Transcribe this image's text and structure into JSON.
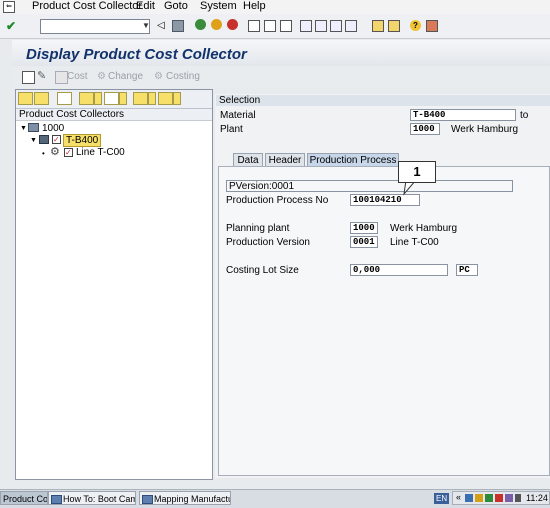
{
  "menu": {
    "items": [
      "Product Cost Collector",
      "Edit",
      "Goto",
      "System",
      "Help"
    ]
  },
  "command_field": {
    "value": ""
  },
  "title": "Display Product Cost Collector",
  "app_toolbar": {
    "cost": "Cost",
    "change": "Change",
    "costing": "Costing"
  },
  "tree": {
    "header": "Product Cost Collectors",
    "nodes": {
      "root": "1000",
      "material": "T-B400",
      "line": "Line T-C00"
    }
  },
  "selection": {
    "header": "Selection",
    "material_label": "Material",
    "material_value": "T-B400",
    "to_label": "to",
    "plant_label": "Plant",
    "plant_value": "1000",
    "plant_name": "Werk Hamburg"
  },
  "tabs": [
    "Data",
    "Header",
    "Production Process"
  ],
  "active_tab": "Production Process",
  "production_process": {
    "pversion": "PVersion:0001",
    "process_no_label": "Production Process No",
    "process_no_value": "100104210",
    "planning_plant_label": "Planning plant",
    "planning_plant_value": "1000",
    "planning_plant_name": "Werk Hamburg",
    "prod_version_label": "Production Version",
    "prod_version_value": "0001",
    "prod_version_name": "Line T-C00",
    "lot_size_label": "Costing Lot Size",
    "lot_size_value": "0,000",
    "lot_size_unit": "PC"
  },
  "callout_number": "1",
  "taskbar": {
    "tasks": [
      "Product Cost ...",
      "How To: Boot Camp - Ta...",
      "Mapping Manufacturing t..."
    ],
    "lang": "EN",
    "clock": "11:24"
  },
  "colors": {
    "title_text": "#12326b",
    "active_tab": "#c7d6e8",
    "selected_node": "#f7e06a"
  }
}
